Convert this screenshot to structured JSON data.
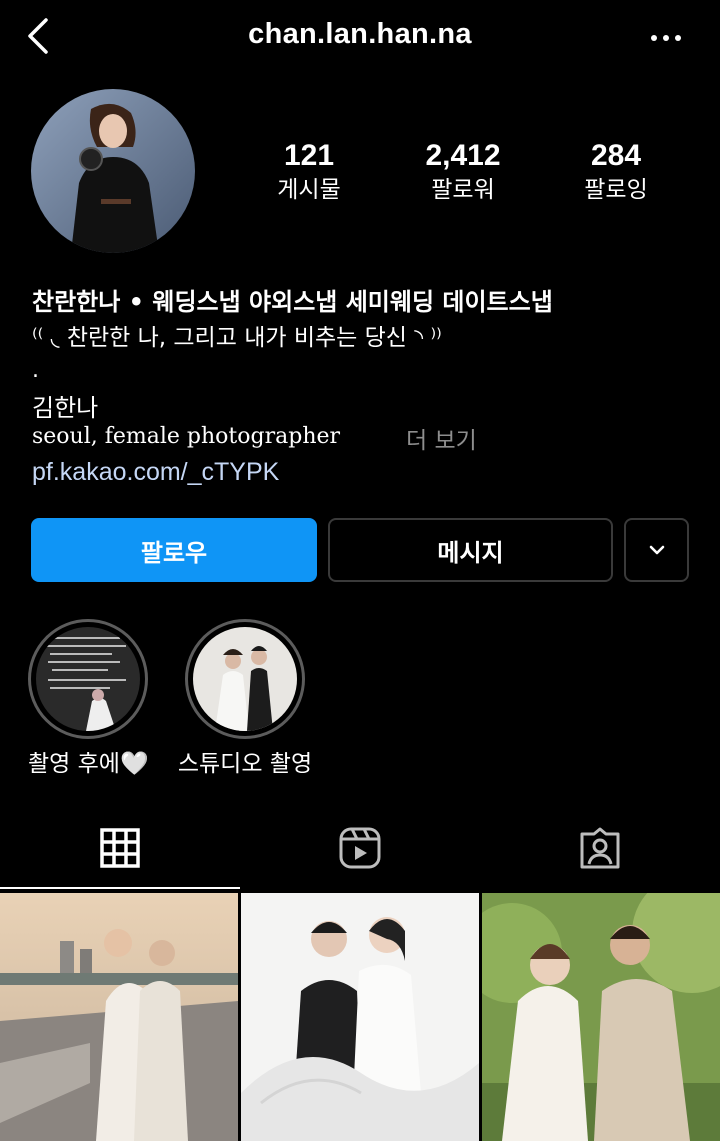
{
  "header": {
    "username": "chan.lan.han.na"
  },
  "stats": [
    {
      "value": "121",
      "label": "게시물"
    },
    {
      "value": "2,412",
      "label": "팔로워"
    },
    {
      "value": "284",
      "label": "팔로잉"
    }
  ],
  "bio": {
    "name": "찬란한나 • 웨딩스냅 야외스냅 세미웨딩 데이트스냅",
    "line": "⁽⁽ ◟ 찬란한 나, 그리고 내가 비추는 당신 ◝ ⁾⁾",
    "dot": ".",
    "person": "김한나",
    "tagline": "seoul, female photographer",
    "more": "더 보기",
    "link": "pf.kakao.com/_cTYPK"
  },
  "buttons": {
    "follow": "팔로우",
    "message": "메시지"
  },
  "highlights": [
    {
      "label": "촬영 후에🤍"
    },
    {
      "label": "스튜디오 촬영"
    }
  ],
  "colors": {
    "accent": "#0f95f6",
    "link": "#c5d7f5",
    "muted": "#8e8e8e"
  },
  "tabs": [
    "grid-icon",
    "reels-icon",
    "tagged-icon"
  ]
}
